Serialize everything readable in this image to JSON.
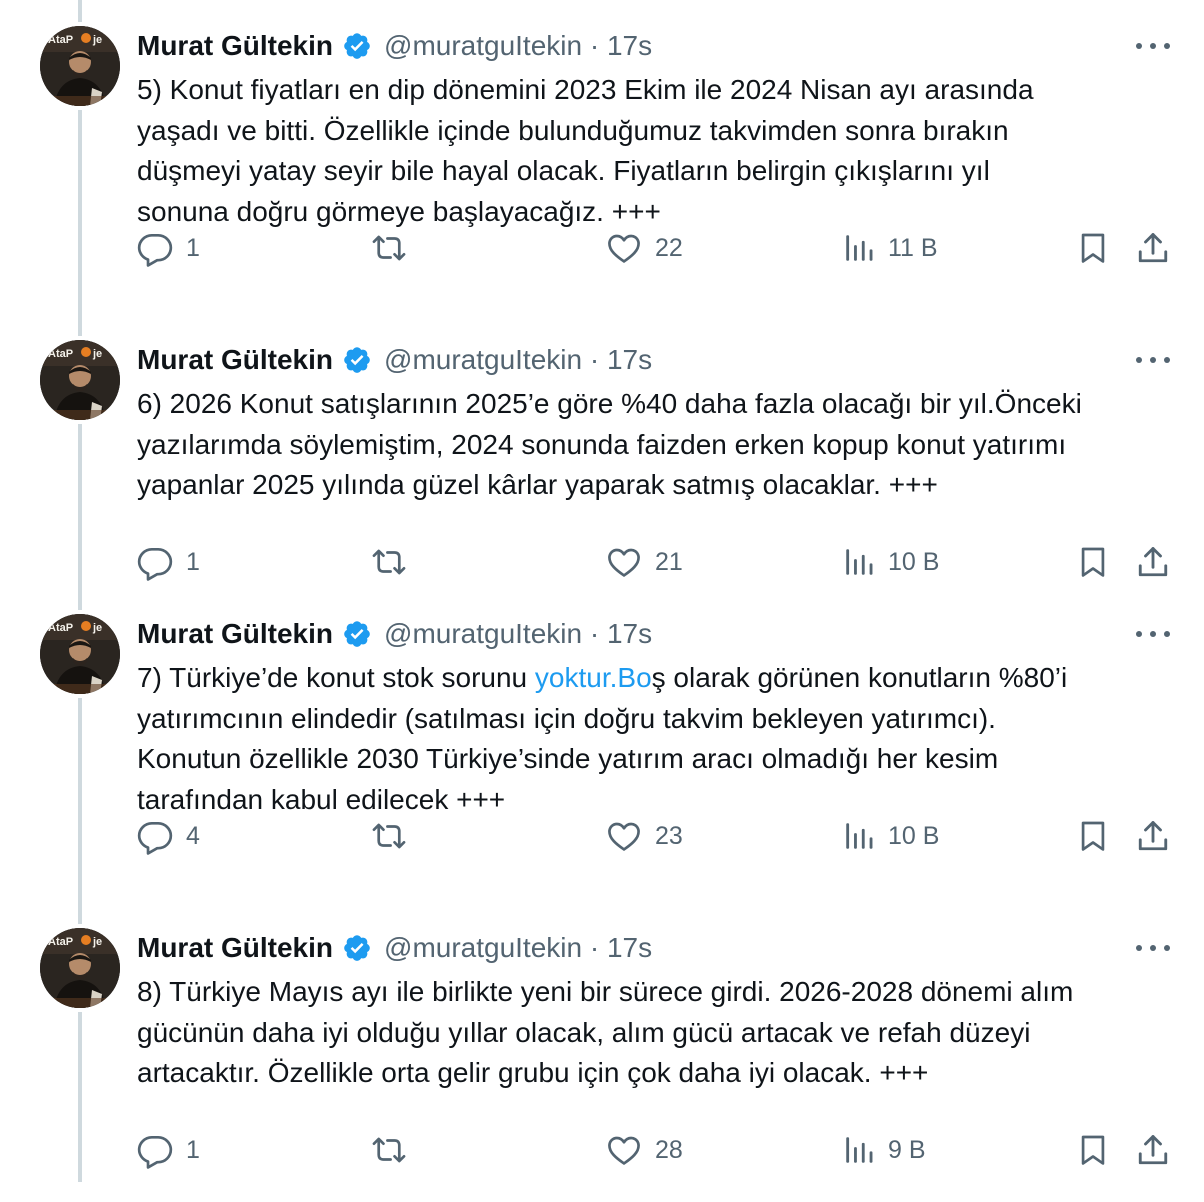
{
  "colors": {
    "text": "#0f1419",
    "secondary": "#536471",
    "link": "#1d9bf0",
    "verified": "#1d9bf0",
    "thread_line": "#cfd9de"
  },
  "icons": {
    "reply": "comment-bubble-icon",
    "retweet": "retweet-arrows-icon",
    "like": "heart-icon",
    "views": "bar-chart-icon",
    "bookmark": "bookmark-icon",
    "share": "share-upload-icon",
    "more": "three-dots-icon",
    "verified": "verified-badge-icon"
  },
  "tweets": [
    {
      "author": "Murat Gültekin",
      "meta": "@muratguItekin · 17s",
      "text_parts": [
        "5) Konut fiyatları en dip dönemini 2023 Ekim ile 2024 Nisan ayı arasında\nyaşadı ve bitti. Özellikle içinde bulunduğumuz takvimden sonra bırakın\ndüşmeyi yatay seyir bile hayal olacak. Fiyatların belirgin çıkışlarını yıl\nsonuna doğru görmeye başlayacağız. +++"
      ],
      "replies": "1",
      "retweets": "",
      "likes": "22",
      "views": "11 B"
    },
    {
      "author": "Murat Gültekin",
      "meta": "@muratguItekin · 17s",
      "text_parts": [
        "6) 2026 Konut satışlarının 2025’e göre %40 daha fazla olacağı bir yıl.Önceki\nyazılarımda söylemiştim, 2024 sonunda faizden erken kopup konut yatırımı\nyapanlar 2025 yılında güzel kârlar yaparak satmış olacaklar. +++"
      ],
      "replies": "1",
      "retweets": "",
      "likes": "21",
      "views": "10 B"
    },
    {
      "author": "Murat Gültekin",
      "meta": "@muratguItekin · 17s",
      "text_parts": [
        "7) Türkiye’de konut stok sorunu ",
        "yoktur.Bo",
        "ş olarak görünen konutların %80’i\nyatırımcının elindedir (satılması için doğru takvim bekleyen yatırımcı).\nKonutun özellikle 2030 Türkiye’sinde yatırım aracı olmadığı her kesim\ntarafından kabul edilecek +++"
      ],
      "replies": "4",
      "retweets": "",
      "likes": "23",
      "views": "10 B"
    },
    {
      "author": "Murat Gültekin",
      "meta": "@muratguItekin · 17s",
      "text_parts": [
        "8) Türkiye Mayıs ayı ile birlikte yeni bir sürece girdi. 2026-2028 dönemi alım\ngücünün daha iyi olduğu yıllar olacak, alım gücü artacak ve refah düzeyi\nartacaktır. Özellikle orta gelir grubu için çok daha iyi olacak. +++"
      ],
      "replies": "1",
      "retweets": "",
      "likes": "28",
      "views": "9 B"
    }
  ]
}
